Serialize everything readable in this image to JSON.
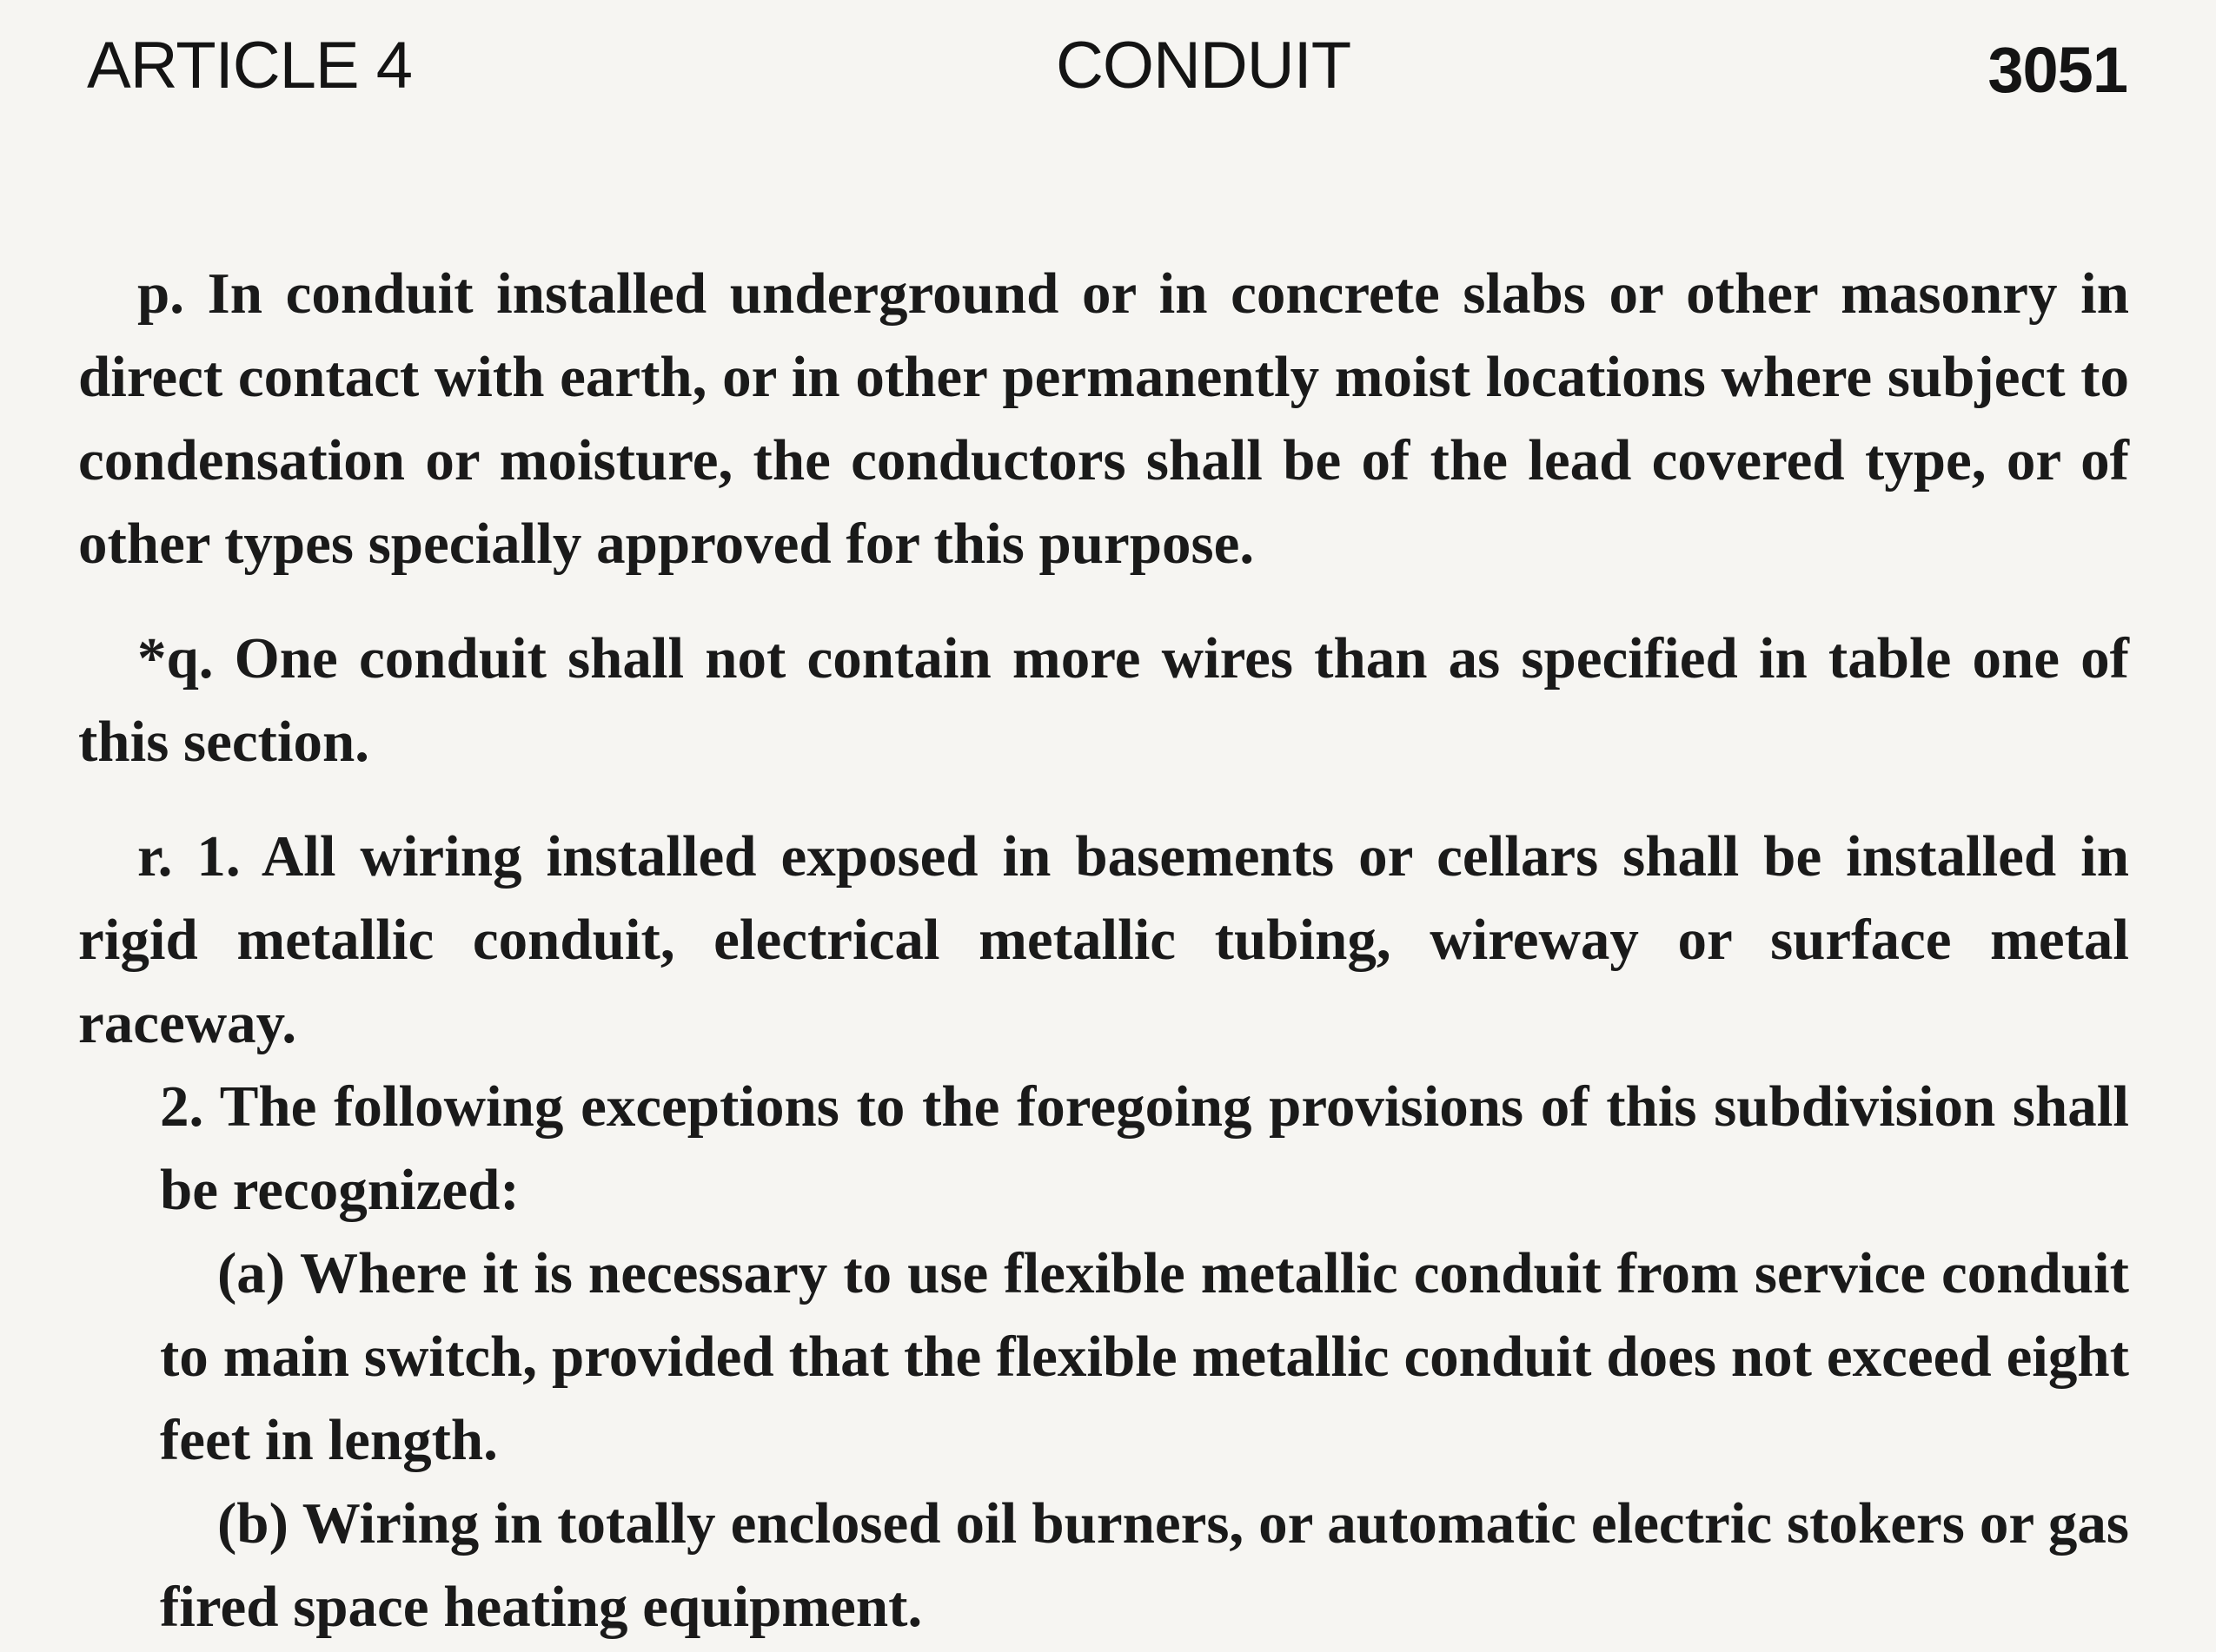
{
  "header": {
    "left": "ARTICLE 4",
    "center": "CONDUIT",
    "right": "3051"
  },
  "paragraphs": {
    "p": "p. In conduit installed underground or in concrete slabs or other masonry in direct contact with earth, or in other permanently moist locations where subject to condensation or moisture, the conductors shall be of the lead covered type, or of other types specially approved for this purpose.",
    "q": "*q. One conduit shall not contain more wires than as specified in table one of this section.",
    "r1": "r. 1. All wiring installed exposed in basements or cellars shall be installed in rigid metallic conduit, electrical metallic tubing, wireway or surface metal raceway.",
    "r2": "2. The following exceptions to the foregoing provisions of this subdivision shall be recognized:",
    "r2a": "(a) Where it is necessary to use flexible metallic conduit from service conduit to main switch, provided that the flexible metallic conduit does not exceed eight feet in length.",
    "r2b": "(b) Wiring in totally enclosed oil burners, or automatic electric stokers or gas fired space heating equipment."
  }
}
